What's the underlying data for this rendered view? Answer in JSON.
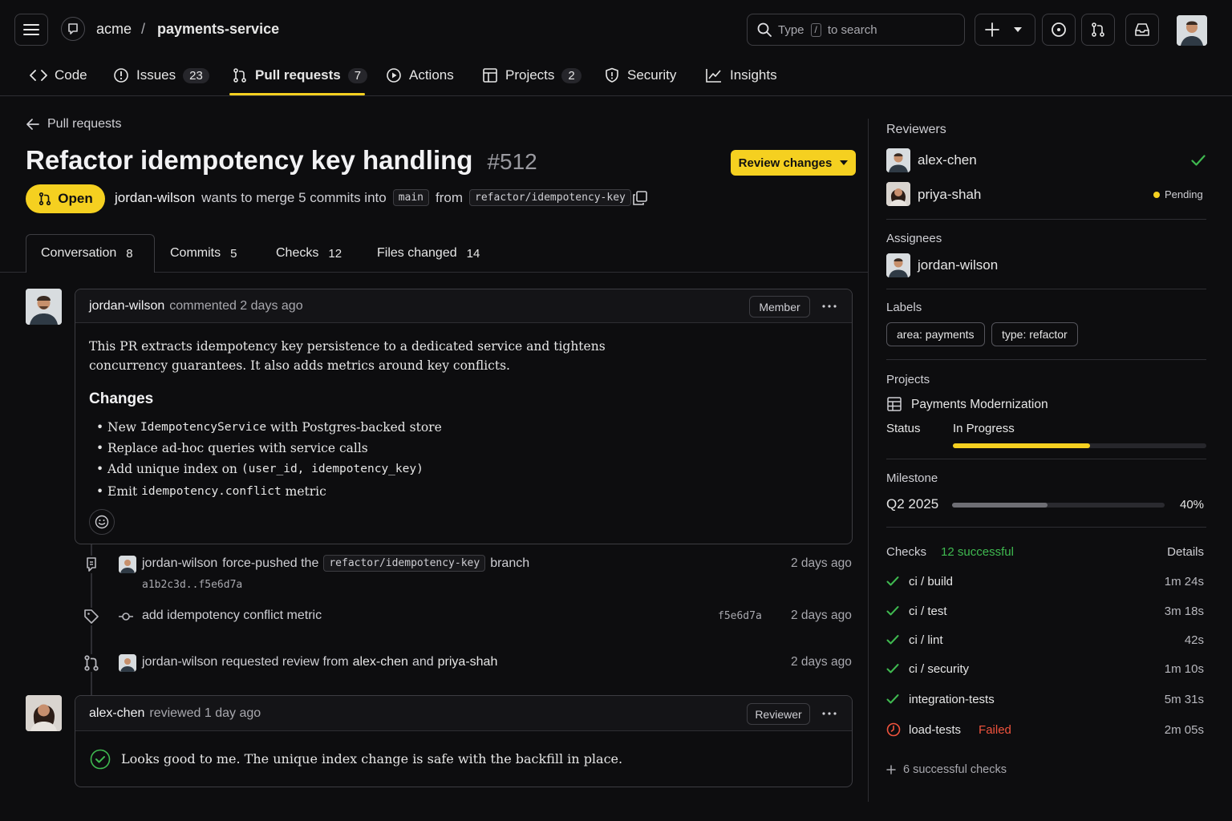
{
  "header": {
    "owner": "acme",
    "separator": "/",
    "repo": "payments-service",
    "search": {
      "type_label": "Type",
      "key": "/",
      "suffix": "to search"
    }
  },
  "repo_tabs": [
    {
      "label": "Code",
      "count": null
    },
    {
      "label": "Issues",
      "count": "23"
    },
    {
      "label": "Pull requests",
      "count": "7"
    },
    {
      "label": "Actions",
      "count": null
    },
    {
      "label": "Projects",
      "count": "2"
    },
    {
      "label": "Security",
      "count": null
    },
    {
      "label": "Insights",
      "count": null
    }
  ],
  "pr": {
    "back_link": "Pull requests",
    "title": "Refactor idempotency key handling",
    "number": "#512",
    "review_button": "Review changes",
    "state": "Open",
    "author": "jordan-wilson",
    "merge_text": "wants to merge 5 commits into",
    "base_branch": "main",
    "from_text": "from",
    "head_branch": "refactor/idempotency-key"
  },
  "pr_tabs": [
    {
      "label": "Conversation",
      "count": "8"
    },
    {
      "label": "Commits",
      "count": "5"
    },
    {
      "label": "Checks",
      "count": "12"
    },
    {
      "label": "Files changed",
      "count": "14"
    }
  ],
  "comment1": {
    "author": "jordan-wilson",
    "meta": "commented 2 days ago",
    "badge": "Member",
    "para_line1": "This PR extracts idempotency key persistence to a dedicated service and tightens",
    "para_line2": "concurrency guarantees. It also adds metrics around key conflicts.",
    "heading": "Changes",
    "bullets": [
      {
        "pre": "New ",
        "code": "IdempotencyService",
        "post": " with Postgres-backed store"
      },
      {
        "pre": "Replace ad-hoc queries with service calls",
        "code": "",
        "post": ""
      },
      {
        "pre": "Add unique index on ",
        "code": "(user_id, idempotency_key)",
        "post": ""
      },
      {
        "pre": "Emit ",
        "code": "idempotency.conflict",
        "post": " metric"
      }
    ]
  },
  "timeline": [
    {
      "actor": "jordan-wilson",
      "text": "force-pushed the",
      "branch": "refactor/idempotency-key",
      "suffix": "branch",
      "sub": "a1b2c3d..f5e6d7a",
      "time": "2 days ago"
    },
    {
      "text": "add idempotency conflict metric",
      "sha": "f5e6d7a",
      "time": "2 days ago"
    },
    {
      "actor": "jordan-wilson",
      "text_a": "requested review from",
      "r1": "alex-chen",
      "and": "and",
      "r2": "priya-shah",
      "time": "2 days ago"
    }
  ],
  "comment2": {
    "author": "alex-chen",
    "meta": "reviewed 1 day ago",
    "badge": "Reviewer",
    "body": "Looks good to me. The unique index change is safe with the backfill in place."
  },
  "sidebar": {
    "reviewers_title": "Reviewers",
    "reviewers": [
      {
        "name": "alex-chen",
        "status": ""
      },
      {
        "name": "priya-shah",
        "status": "Pending"
      }
    ],
    "assignees_title": "Assignees",
    "assignee": "jordan-wilson",
    "labels_title": "Labels",
    "labels": [
      "area: payments",
      "type: refactor"
    ],
    "projects_title": "Projects",
    "project_name": "Payments Modernization",
    "status_label": "Status",
    "status_value": "In Progress",
    "status_progress": 0.54,
    "milestone_title": "Milestone",
    "milestone_name": "Q2 2025",
    "milestone_percent": "40%",
    "milestone_progress": 0.45,
    "checks_title": "Checks",
    "checks_summary": "12 successful",
    "checks_details": "Details",
    "checks": [
      {
        "name": "ci / build",
        "status": "",
        "time": "1m 24s"
      },
      {
        "name": "ci / test",
        "status": "",
        "time": "3m 18s"
      },
      {
        "name": "ci / lint",
        "status": "",
        "time": "42s"
      },
      {
        "name": "ci / security",
        "status": "",
        "time": "1m 10s"
      },
      {
        "name": "integration-tests",
        "status": "",
        "time": "5m 31s"
      },
      {
        "name": "load-tests",
        "status": "Failed",
        "time": "2m 05s"
      }
    ],
    "more_checks": "6 successful checks"
  },
  "colors": {
    "accent": "#f5d020",
    "success": "#3fb950",
    "danger": "#f0533d"
  }
}
